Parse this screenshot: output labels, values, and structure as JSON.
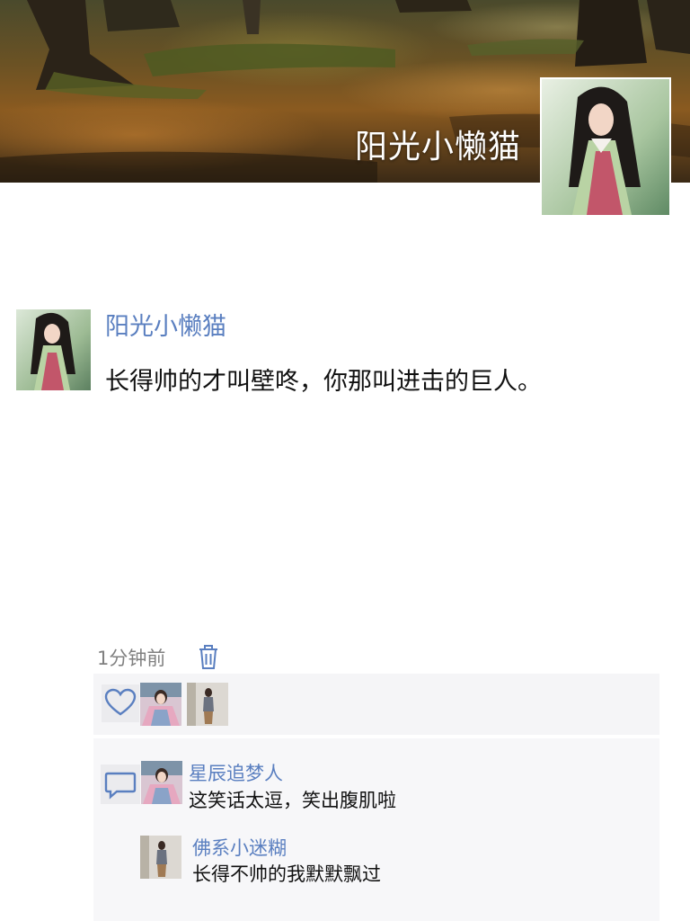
{
  "cover": {
    "name": "阳光小懒猫"
  },
  "post": {
    "author": "阳光小懒猫",
    "text": "长得帅的才叫壁咚，你那叫进击的巨人。",
    "time": "1分钟前"
  },
  "icons": {
    "delete": "trash-icon",
    "like": "heart-icon",
    "comment": "comment-icon"
  },
  "comments": [
    {
      "author": "星辰追梦人",
      "text": "这笑话太逗，笑出腹肌啦"
    },
    {
      "author": "佛系小迷糊",
      "text": "长得不帅的我默默飘过"
    }
  ],
  "colors": {
    "link": "#5a7fc0",
    "text": "#111111",
    "meta": "#808080",
    "panel": "#f5f5f7"
  }
}
